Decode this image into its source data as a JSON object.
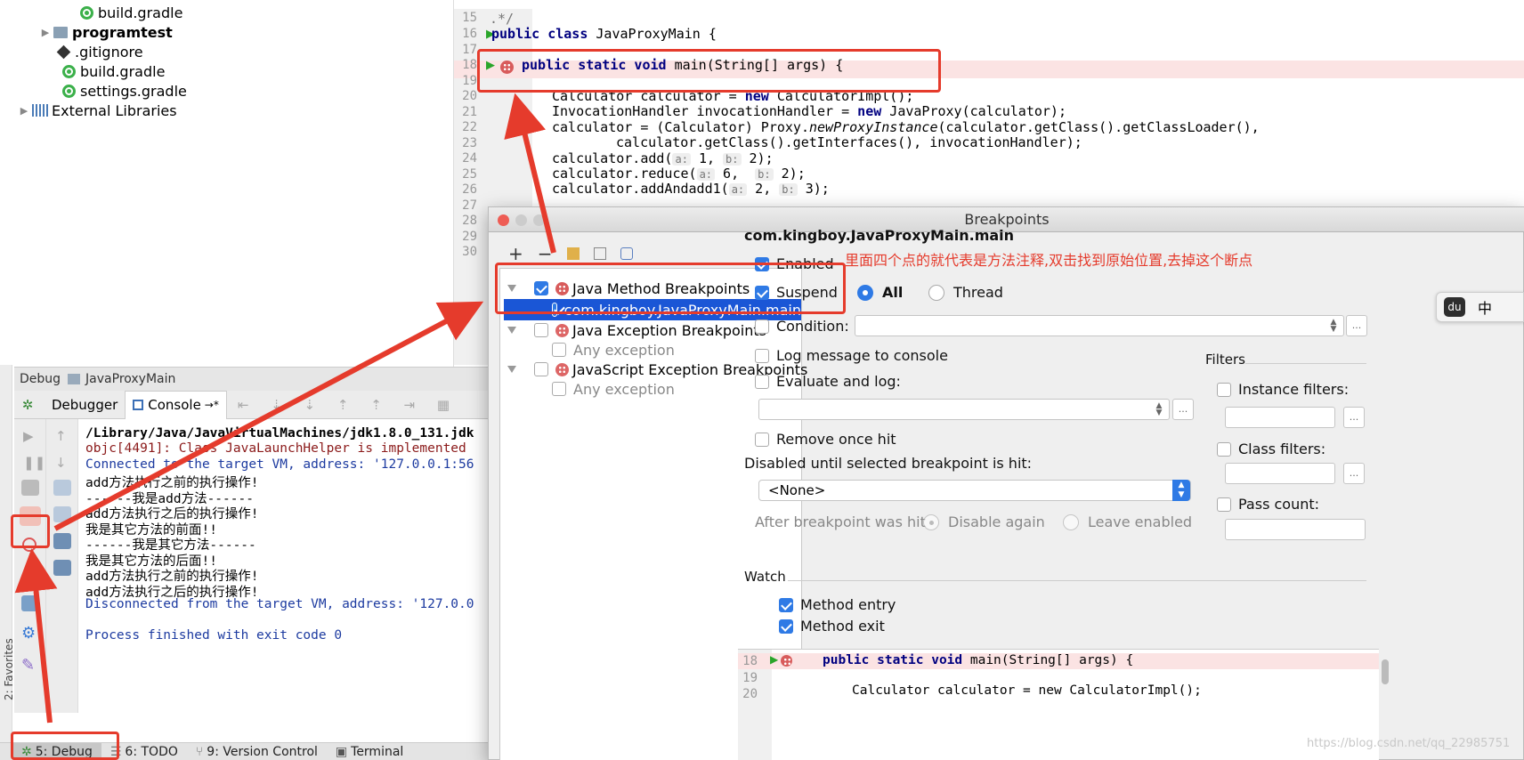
{
  "project_tree": [
    {
      "label": "build.gradle",
      "icon": "gradle-icon"
    },
    {
      "label": "programtest",
      "icon": "folder-icon"
    },
    {
      "label": ".gitignore",
      "icon": "gitignore-icon"
    },
    {
      "label": "build.gradle",
      "icon": "gradle-icon"
    },
    {
      "label": "settings.gradle",
      "icon": "gradle-icon"
    },
    {
      "label": "External Libraries",
      "icon": "libraries-icon"
    }
  ],
  "editor": {
    "line_numbers": [
      "15",
      "16",
      "17",
      "18",
      "19",
      "20",
      "21",
      "22",
      "23",
      "24",
      "25",
      "26",
      "27",
      "28",
      "29",
      "30"
    ],
    "lines": {
      "l15": ".*/",
      "l16_kw": "public class",
      "l16_rest": " JavaProxyMain {",
      "l18_kw": "public static void",
      "l18_rest": " main(String[] args) {",
      "l20_a": "Calculator calculator = ",
      "l20_kw": "new",
      "l20_b": " CalculatorImpl();",
      "l21_a": "InvocationHandler invocationHandler = ",
      "l21_kw": "new",
      "l21_b": " JavaProxy(calculator);",
      "l22_a": "calculator = (Calculator) Proxy.",
      "l22_it": "newProxyInstance",
      "l22_b": "(calculator.getClass().getClassLoader(),",
      "l23": "calculator.getClass().getInterfaces(), invocationHandler);",
      "l24_a": "calculator.add(",
      "l24_h1": "a:",
      "l24_v1": " 1, ",
      "l24_h2": "b:",
      "l24_v2": " 2);",
      "l25_a": "calculator.reduce(",
      "l25_h1": "a:",
      "l25_v1": " 6,  ",
      "l25_h2": "b:",
      "l25_v2": " 2);",
      "l26_a": "calculator.addAndadd1(",
      "l26_h1": "a:",
      "l26_v1": " 2, ",
      "l26_h2": "b:",
      "l26_v2": " 3);"
    }
  },
  "debug": {
    "title": "Debug",
    "config": "JavaProxyMain",
    "tabs": {
      "debugger": "Debugger",
      "console": "Console",
      "console_suffix": "→*"
    },
    "console_lines": [
      {
        "text": "/Library/Java/JavaVirtualMachines/jdk1.8.0_131.jdk",
        "cls": "cblue"
      },
      {
        "text": "objc[4491]: Class JavaLaunchHelper is implemented",
        "cls": "cred"
      },
      {
        "text": "Connected to the target VM, address: '127.0.0.1:56",
        "cls": "cblue"
      },
      {
        "text": "add方法执行之前的执行操作!",
        "cls": ""
      },
      {
        "text": "------我是add方法------",
        "cls": ""
      },
      {
        "text": "add方法执行之后的执行操作!",
        "cls": ""
      },
      {
        "text": "我是其它方法的前面!!",
        "cls": ""
      },
      {
        "text": "------我是其它方法------",
        "cls": ""
      },
      {
        "text": "我是其它方法的后面!!",
        "cls": ""
      },
      {
        "text": "add方法执行之前的执行操作!",
        "cls": ""
      },
      {
        "text": "add方法执行之后的执行操作!",
        "cls": ""
      },
      {
        "text": "Disconnected from the target VM, address: '127.0.0",
        "cls": "cblue"
      },
      {
        "text": "",
        "cls": ""
      },
      {
        "text": "Process finished with exit code 0",
        "cls": "cblue"
      }
    ]
  },
  "bottom_tabs": [
    "5: Debug",
    "6: TODO",
    "9: Version Control",
    "Terminal"
  ],
  "favorites_label": "2: Favorites",
  "dialog": {
    "title": "Breakpoints",
    "toolbar": {
      "add": "+",
      "remove": "−"
    },
    "list": [
      {
        "label": "Java Method Breakpoints",
        "checked": true
      },
      {
        "label": "com.kingboy.JavaProxyMain.main",
        "checked": true
      },
      {
        "label": "Java Exception Breakpoints",
        "checked": false
      },
      {
        "label": "Any exception",
        "checked": false
      },
      {
        "label": "JavaScript Exception Breakpoints",
        "checked": false
      },
      {
        "label": "Any exception",
        "checked": false
      }
    ],
    "detail": {
      "heading": "com.kingboy.JavaProxyMain.main",
      "enabled": "Enabled",
      "annotation": "里面四个点的就代表是方法注释,双击找到原始位置,去掉这个断点",
      "suspend": "Suspend",
      "all": "All",
      "thread": "Thread",
      "condition": "Condition:",
      "log_message": "Log message to console",
      "evaluate": "Evaluate and log:",
      "remove_once": "Remove once hit",
      "disabled_until": "Disabled until selected breakpoint is hit:",
      "none_option": "<None>",
      "after_hit": "After breakpoint was hit",
      "disable_again": "Disable again",
      "leave_enabled": "Leave enabled",
      "filters": "Filters",
      "instance_filters": "Instance filters:",
      "class_filters": "Class filters:",
      "pass_count": "Pass count:",
      "watch": "Watch",
      "method_entry": "Method entry",
      "method_exit": "Method exit",
      "ellipsis": "...",
      "preview": {
        "n18": "18",
        "n19": "19",
        "n20": "20",
        "l18_kw": "public static void",
        "l18_rest": " main(String[] args) {",
        "l20": "Calculator calculator = new CalculatorImpl();"
      }
    }
  },
  "ime": {
    "lang": "中",
    "logo": "du"
  },
  "watermark": "https://blog.csdn.net/qq_22985751",
  "colors": {
    "annotation_red": "#e53b2c",
    "selection_blue": "#1a56d6",
    "checkbox_blue": "#2f7ae5",
    "breakpoint_red": "#d85b5b"
  }
}
